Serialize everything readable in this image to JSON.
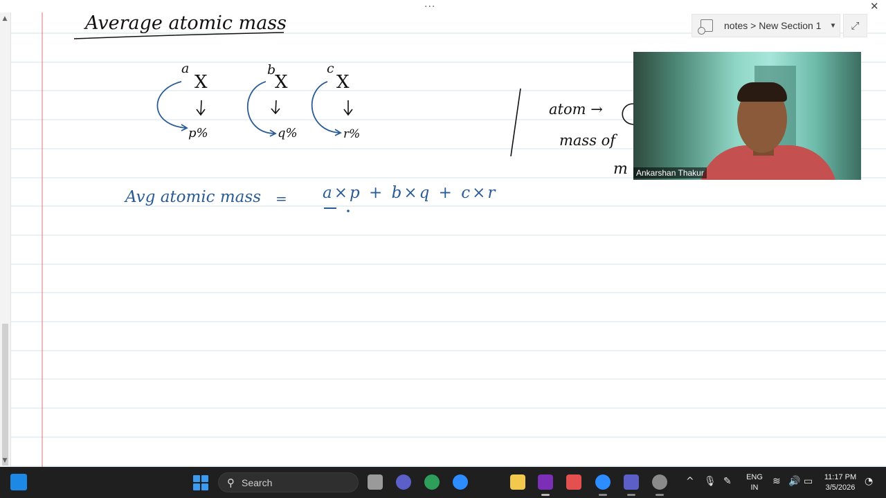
{
  "window": {
    "more_dots": "···",
    "close_glyph": "✕"
  },
  "breadcrumb": {
    "text": "notes > New Section 1",
    "caret": "▼",
    "notebook_icon": "notebook-icon"
  },
  "expand_glyph": "⤢",
  "video": {
    "participant_name": "Ankarshan Thakur"
  },
  "notes": {
    "title": "Average atomic mass",
    "isotopes": [
      {
        "mass": "a",
        "percent": "p%"
      },
      {
        "mass": "b",
        "percent": "q%"
      },
      {
        "mass": "c",
        "percent": "r%"
      }
    ],
    "isotope_symbol": "X",
    "formula_label": "Avg atomic mass",
    "formula_equals": "=",
    "formula_expression": "a×p + b×q + c×r",
    "side_line1": "atom →",
    "side_line2": "mass of",
    "side_line3": "m"
  },
  "taskbar": {
    "search_label": "Search",
    "language_line1": "ENG",
    "language_line2": "IN",
    "time": "11:17 PM",
    "date": "3/5/2026",
    "pinned_apps": [
      "file-explorer",
      "video-call",
      "hindi-input",
      "browser",
      "folder",
      "onenote",
      "snipping-tool",
      "zoom",
      "teams",
      "settings"
    ],
    "colors": {
      "taskbar_bg": "#1f1f1f",
      "start_blue": "#3a9bf0",
      "onenote_purple": "#7b2fb7",
      "zoom_blue": "#2d8cff",
      "ink_blue": "#2a5b95",
      "margin_red": "#e07070"
    }
  }
}
